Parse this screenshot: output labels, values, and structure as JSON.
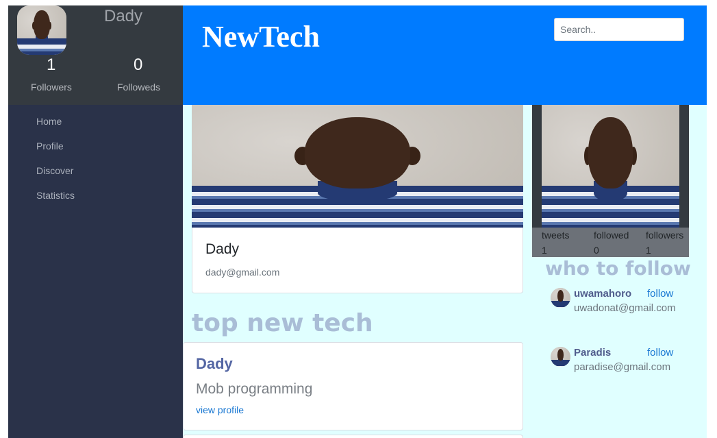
{
  "sidebar": {
    "user_name": "Dady",
    "stats": [
      {
        "value": "1",
        "label": "Followers"
      },
      {
        "value": "0",
        "label": "Followeds"
      }
    ],
    "nav": [
      "Home",
      "Profile",
      "Discover",
      "Statistics"
    ]
  },
  "header": {
    "brand": "NewTech",
    "search_placeholder": "Search.."
  },
  "profile_card": {
    "name": "Dady",
    "email": "dady@gmail.com"
  },
  "feed": {
    "title": "top new tech",
    "tweets": [
      {
        "author": "Dady",
        "text": "Mob programming",
        "link": "view profile"
      }
    ]
  },
  "right_stats": {
    "labels": [
      "tweets",
      "followed",
      "followers"
    ],
    "values": [
      "1",
      "0",
      "1"
    ]
  },
  "who_to_follow": {
    "title": "who to follow",
    "users": [
      {
        "name": "uwamahoro",
        "email": "uwadonat@gmail.com",
        "action": "follow"
      },
      {
        "name": "Paradis",
        "email": "paradise@gmail.com",
        "action": "follow"
      }
    ]
  },
  "colors": {
    "header": "#007bff",
    "sidebar": "#2a3249",
    "content_bg": "#e0ffff",
    "profile_box": "#343a40"
  }
}
